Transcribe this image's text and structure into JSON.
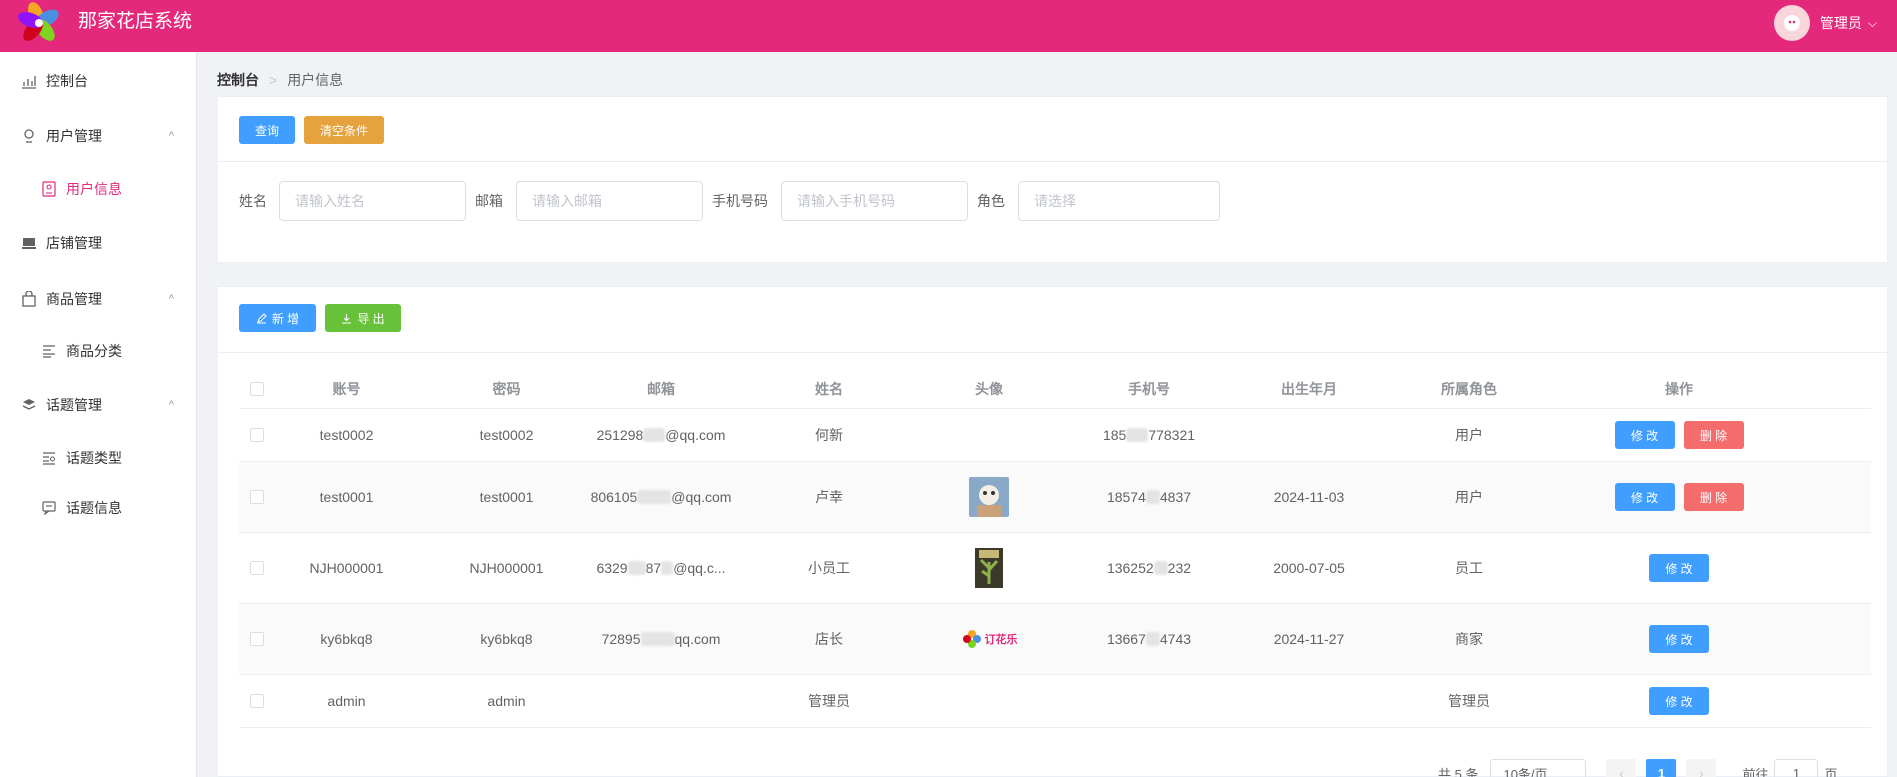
{
  "header": {
    "title": "那家花店系统",
    "user_label": "管理员",
    "chevron": "⌵"
  },
  "sidebar": {
    "items": [
      {
        "label": "控制台",
        "icon": "dashboard-icon"
      },
      {
        "label": "用户管理",
        "icon": "user-manage-icon",
        "arrow": "^"
      },
      {
        "label": "用户信息",
        "icon": "user-info-icon"
      },
      {
        "label": "店铺管理",
        "icon": "shop-icon"
      },
      {
        "label": "商品管理",
        "icon": "bag-icon",
        "arrow": "^"
      },
      {
        "label": "商品分类",
        "icon": "category-icon"
      },
      {
        "label": "话题管理",
        "icon": "layers-icon",
        "arrow": "^"
      },
      {
        "label": "话题类型",
        "icon": "topic-type-icon"
      },
      {
        "label": "话题信息",
        "icon": "message-icon"
      }
    ]
  },
  "breadcrumb": {
    "home": "控制台",
    "separator": ">",
    "current": "用户信息"
  },
  "search": {
    "query_label": "查询",
    "clear_label": "清空条件",
    "fields": [
      {
        "label": "姓名",
        "placeholder": "请输入姓名"
      },
      {
        "label": "邮箱",
        "placeholder": "请输入邮箱"
      },
      {
        "label": "手机号码",
        "placeholder": "请输入手机号码"
      },
      {
        "label": "角色",
        "placeholder": "请选择"
      }
    ]
  },
  "toolbar": {
    "add_label": "新 增",
    "export_label": "导 出"
  },
  "table": {
    "headers": [
      "账号",
      "密码",
      "邮箱",
      "姓名",
      "头像",
      "手机号",
      "出生年月",
      "所属角色",
      "操作"
    ],
    "edit_label": "修 改",
    "delete_label": "删 除",
    "rows": [
      {
        "account": "test0002",
        "password": "test0002",
        "email_a": "251298",
        "email_b": "@qq.com",
        "name": "何新",
        "avatar": "",
        "phone_a": "185",
        "phone_b": "778321",
        "birth": "",
        "role": "用户"
      },
      {
        "account": "test0001",
        "password": "test0001",
        "email_a": "806105",
        "email_b": "@qq.com",
        "name": "卢幸",
        "avatar": "cat-photo",
        "phone_a": "18574",
        "phone_b": "4837",
        "birth": "2024-11-03",
        "role": "用户"
      },
      {
        "account": "NJH000001",
        "password": "NJH000001",
        "email_a": "6329",
        "email_b": "87",
        "email_c": "@qq.c...",
        "name": "小员工",
        "avatar": "plant-photo",
        "phone_a": "136252",
        "phone_b": "232",
        "birth": "2000-07-05",
        "role": "员工"
      },
      {
        "account": "ky6bkq8",
        "password": "ky6bkq8",
        "email_a": "72895",
        "email_b": "qq.com",
        "name": "店长",
        "avatar": "flower-logo",
        "avatar_text": "订花乐",
        "phone_a": "13667",
        "phone_b": "4743",
        "birth": "2024-11-27",
        "role": "商家"
      },
      {
        "account": "admin",
        "password": "admin",
        "email_a": "",
        "email_b": "",
        "name": "管理员",
        "avatar": "",
        "phone_a": "",
        "phone_b": "",
        "birth": "",
        "role": "管理员"
      }
    ]
  },
  "pagination": {
    "total": "共 5 条",
    "page_size": "10条/页",
    "current_page": "1",
    "goto_label": "前往",
    "goto_value": "1",
    "page_unit": "页",
    "prev": "‹",
    "next": "›"
  }
}
